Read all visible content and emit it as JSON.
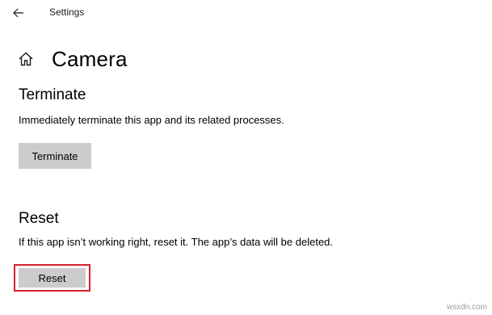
{
  "window": {
    "title": "Settings"
  },
  "header": {
    "title": "Camera"
  },
  "terminate": {
    "heading": "Terminate",
    "description": "Immediately terminate this app and its related processes.",
    "button_label": "Terminate"
  },
  "reset": {
    "heading": "Reset",
    "description": "If this app isn’t working right, reset it. The app’s data will be deleted.",
    "button_label": "Reset"
  },
  "watermark": {
    "text": "wsxdn.com"
  },
  "colors": {
    "button_bg": "#cccccc",
    "highlight": "#d4202a"
  },
  "icons": {
    "back": "back-arrow-icon",
    "home": "home-icon"
  }
}
